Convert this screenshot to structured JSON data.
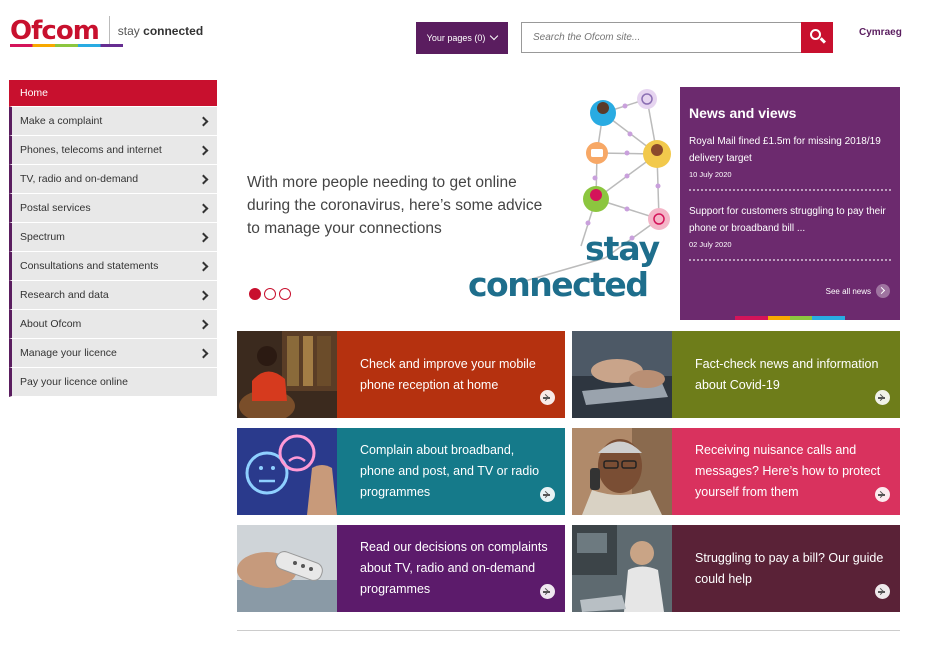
{
  "header": {
    "logo_text": "Ofcom",
    "tagline_prefix": "stay",
    "tagline_bold": "connected",
    "your_pages_label": "Your pages (0)",
    "search_placeholder": "Search the Ofcom site...",
    "search_icon": "search-icon",
    "language_link": "Cymraeg"
  },
  "sidebar": {
    "items": [
      {
        "label": "Home",
        "active": true,
        "has_arrow": false
      },
      {
        "label": "Make a complaint",
        "has_arrow": true
      },
      {
        "label": "Phones, telecoms and internet",
        "has_arrow": true
      },
      {
        "label": "TV, radio and on-demand",
        "has_arrow": true
      },
      {
        "label": "Postal services",
        "has_arrow": true
      },
      {
        "label": "Spectrum",
        "has_arrow": true
      },
      {
        "label": "Consultations and statements",
        "has_arrow": true
      },
      {
        "label": "Research and data",
        "has_arrow": true
      },
      {
        "label": "About Ofcom",
        "has_arrow": true
      },
      {
        "label": "Manage your licence",
        "has_arrow": true
      },
      {
        "label": "Pay your licence online",
        "has_arrow": false
      }
    ]
  },
  "hero": {
    "text": "With more people needing to get online during the coronavirus, here’s some advice to manage your connections",
    "slide_count": 3,
    "active_slide": 1,
    "graphic_word_1": "stay",
    "graphic_word_2": "connected"
  },
  "news": {
    "heading": "News and views",
    "items": [
      {
        "title": "Royal Mail fined £1.5m for missing 2018/19 delivery target",
        "date": "10 July 2020"
      },
      {
        "title": "Support for customers struggling to pay their phone or broadband bill ...",
        "date": "02 July 2020"
      }
    ],
    "see_all": "See all news"
  },
  "tiles": [
    {
      "text": "Check and improve your mobile phone reception at home",
      "color": "#b5310f"
    },
    {
      "text": "Fact-check news and information about Covid-19",
      "color": "#6e7d1a"
    },
    {
      "text": "Complain about broadband, phone and post, and TV or radio programmes",
      "color": "#157a8a"
    },
    {
      "text": "Receiving nuisance calls and messages? Here’s how to protect yourself from them",
      "color": "#d9325e"
    },
    {
      "text": "Read our decisions on complaints about TV, radio and on-demand programmes",
      "color": "#5c1b6b"
    },
    {
      "text": "Struggling to pay a bill? Our guide could help",
      "color": "#5a2237"
    }
  ],
  "colors": {
    "brand_red": "#c8102e",
    "brand_purple": "#5a1d5f"
  }
}
